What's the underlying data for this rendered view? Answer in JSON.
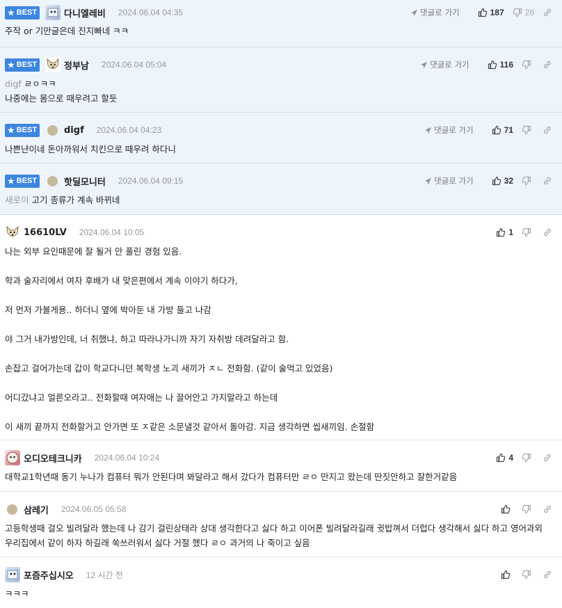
{
  "labels": {
    "best": "BEST",
    "goto": "댓글로 가기"
  },
  "comments": [
    {
      "nick": "다니엘레비",
      "date": "2024.06.04 04:35",
      "up": "187",
      "down": "26",
      "lines": [
        "주작 or 기만글은데 진지빠네 ㅋㅋ"
      ]
    },
    {
      "nick": "정부남",
      "date": "2024.06.04 05:04",
      "up": "116",
      "mention": "digf",
      "lines": [
        "ㄹㅇㅋㅋ",
        "나중에는 몸으로 때우려고 할듯"
      ]
    },
    {
      "nick": "digf",
      "date": "2024.06.04 04:23",
      "up": "71",
      "lines": [
        "나쁜냔이네 돈아까워서 치킨으로 때우려 하다니"
      ]
    },
    {
      "nick": "핫딜모니터",
      "date": "2024.06.04 09:15",
      "up": "32",
      "mention": "새로이",
      "lines": [
        "고기 종류가 계속 바뀌네"
      ]
    },
    {
      "nick": "16610LV",
      "date": "2024.06.04 10:05",
      "up": "1",
      "lines": [
        "나는 외부 요인때문에 잘 될거 안 풀린 경험 있음.",
        "학과 술자리에서 여자 후배가 내 맞은편에서 계속 이야기 하다가,",
        "저 먼저 가볼게용.. 하더니 옆에 박아둔 내 가방 들고 나감",
        "야 그거 내가방인데, 너 취했냐, 하고 따라나가니까 자기 자취방 데려달라고 함.",
        "손잡고 걸어가는데 갑이 학교다니던 복학생 노괴 새끼가 ㅈㄴ 전화함. (같이 술먹고 있었음)",
        "어디갔냐고 얼른오라고.. 전화할때 여자애는 나 끌어안고 가지말라고 하는데",
        "이 새끼 끝까지 전화할거고 안가면 또 ㅈ같은 소문낼것 같아서 돌아감. 지금 생각하면 씹새끼임. 손절함"
      ]
    },
    {
      "nick": "오디오테크니카",
      "date": "2024.06.04 10:24",
      "up": "4",
      "lines": [
        "대학교1학년때 동기 누나가 컴퓨터 뭐가 안된다며 봐달라고 해서 갔다가 컴퓨터만 ㄹㅇ 만지고 왔는데 딴짓안하고 잘한거같음"
      ]
    },
    {
      "nick": "삼레기",
      "date": "2024.06.05 05:58",
      "up": "",
      "lines": [
        "고등학생때 걸오 빌려달라 했는데 나 감기 걸린상태라 상대 생각한다고 싫다 하고 이어폰 빌려달라길래 귓밥껴서 더럽다 생각해서 싫다 하고 영어과외 우리집에서 같이 하자 하길래 쑥쓰러워서 싫다 거절 했다 ㄹㅇ 과거의 나 죽이고 싶음"
      ]
    },
    {
      "nick": "포즘주십시오",
      "date": "12 시간 전",
      "up": "",
      "lines": [
        "ㅋㅋㅋ"
      ]
    }
  ]
}
